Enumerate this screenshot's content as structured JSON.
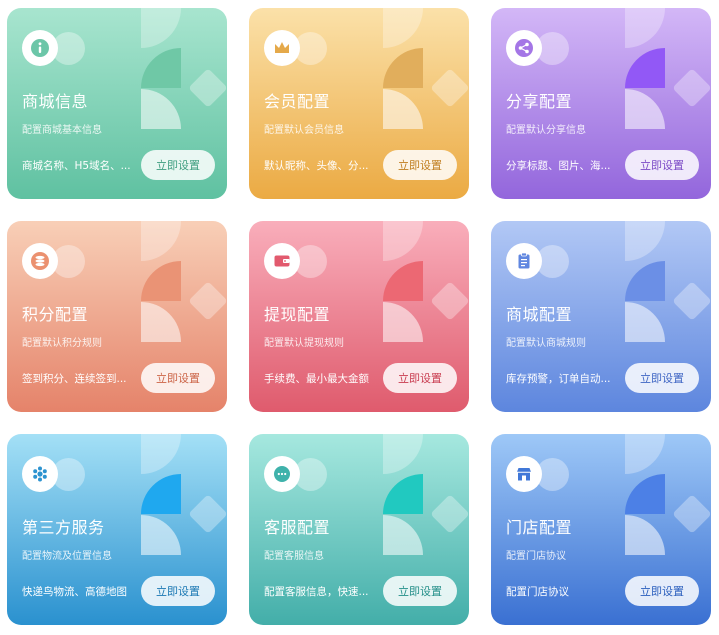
{
  "cards": [
    {
      "title": "商城信息",
      "subtitle": "配置商城基本信息",
      "desc": "商城名称、H5域名、...",
      "button": "立即设置",
      "icon": "info-icon",
      "icon_color": "#5fc1a1",
      "button_color": "#3d9d7f"
    },
    {
      "title": "会员配置",
      "subtitle": "配置默认会员信息",
      "desc": "默认昵称、头像、分...",
      "button": "立即设置",
      "icon": "crown-icon",
      "icon_color": "#e2a545",
      "button_color": "#c07d1e"
    },
    {
      "title": "分享配置",
      "subtitle": "配置默认分享信息",
      "desc": "分享标题、图片、海...",
      "button": "立即设置",
      "icon": "share-icon",
      "icon_color": "#9a6ae0",
      "button_color": "#7a49c6"
    },
    {
      "title": "积分配置",
      "subtitle": "配置默认积分规则",
      "desc": "签到积分、连续签到...",
      "button": "立即设置",
      "icon": "coins-icon",
      "icon_color": "#e88a6c",
      "button_color": "#cc6548"
    },
    {
      "title": "提现配置",
      "subtitle": "配置默认提现规则",
      "desc": "手续费、最小最大金额",
      "button": "立即设置",
      "icon": "wallet-icon",
      "icon_color": "#e25a6e",
      "button_color": "#c93c50"
    },
    {
      "title": "商城配置",
      "subtitle": "配置默认商城规则",
      "desc": "库存预警，订单自动...",
      "button": "立即设置",
      "icon": "clipboard-icon",
      "icon_color": "#6087e0",
      "button_color": "#3f66c4"
    },
    {
      "title": "第三方服务",
      "subtitle": "配置物流及位置信息",
      "desc": "快递鸟物流、高德地图",
      "button": "立即设置",
      "icon": "snowflake-icon",
      "icon_color": "#2c93d0",
      "button_color": "#1b78b4"
    },
    {
      "title": "客服配置",
      "subtitle": "配置客服信息",
      "desc": "配置客服信息，快速...",
      "button": "立即设置",
      "icon": "chat-icon",
      "icon_color": "#3fb2ab",
      "button_color": "#248f89"
    },
    {
      "title": "门店配置",
      "subtitle": "配置门店协议",
      "desc": "配置门店协议",
      "button": "立即设置",
      "icon": "store-icon",
      "icon_color": "#4178d8",
      "button_color": "#2a5ebd"
    }
  ]
}
